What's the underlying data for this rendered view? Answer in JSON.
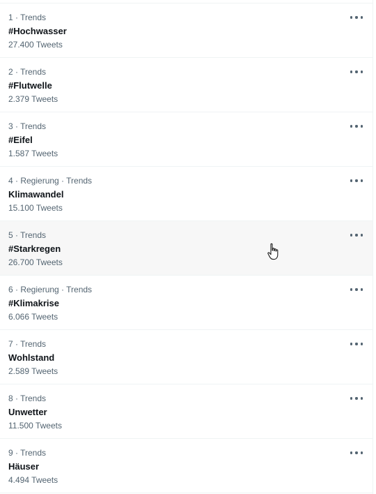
{
  "trends": [
    {
      "meta": "1 · Trends",
      "name": "#Hochwasser",
      "count": "27.400 Tweets"
    },
    {
      "meta": "2 · Trends",
      "name": "#Flutwelle",
      "count": "2.379 Tweets"
    },
    {
      "meta": "3 · Trends",
      "name": "#Eifel",
      "count": "1.587 Tweets"
    },
    {
      "meta": "4 · Regierung · Trends",
      "name": "Klimawandel",
      "count": "15.100 Tweets"
    },
    {
      "meta": "5 · Trends",
      "name": "#Starkregen",
      "count": "26.700 Tweets"
    },
    {
      "meta": "6 · Regierung · Trends",
      "name": "#Klimakrise",
      "count": "6.066 Tweets"
    },
    {
      "meta": "7 · Trends",
      "name": "Wohlstand",
      "count": "2.589 Tweets"
    },
    {
      "meta": "8 · Trends",
      "name": "Unwetter",
      "count": "11.500 Tweets"
    },
    {
      "meta": "9 · Trends",
      "name": "Häuser",
      "count": "4.494 Tweets"
    }
  ],
  "icons": {
    "more": "more-horizontal-icon",
    "cursor": "hand-pointer-cursor-icon"
  },
  "colors": {
    "hover_background": "#f7f7f7",
    "primary_text": "#0f1419",
    "secondary_text": "#536471",
    "divider": "#eff3f4"
  }
}
